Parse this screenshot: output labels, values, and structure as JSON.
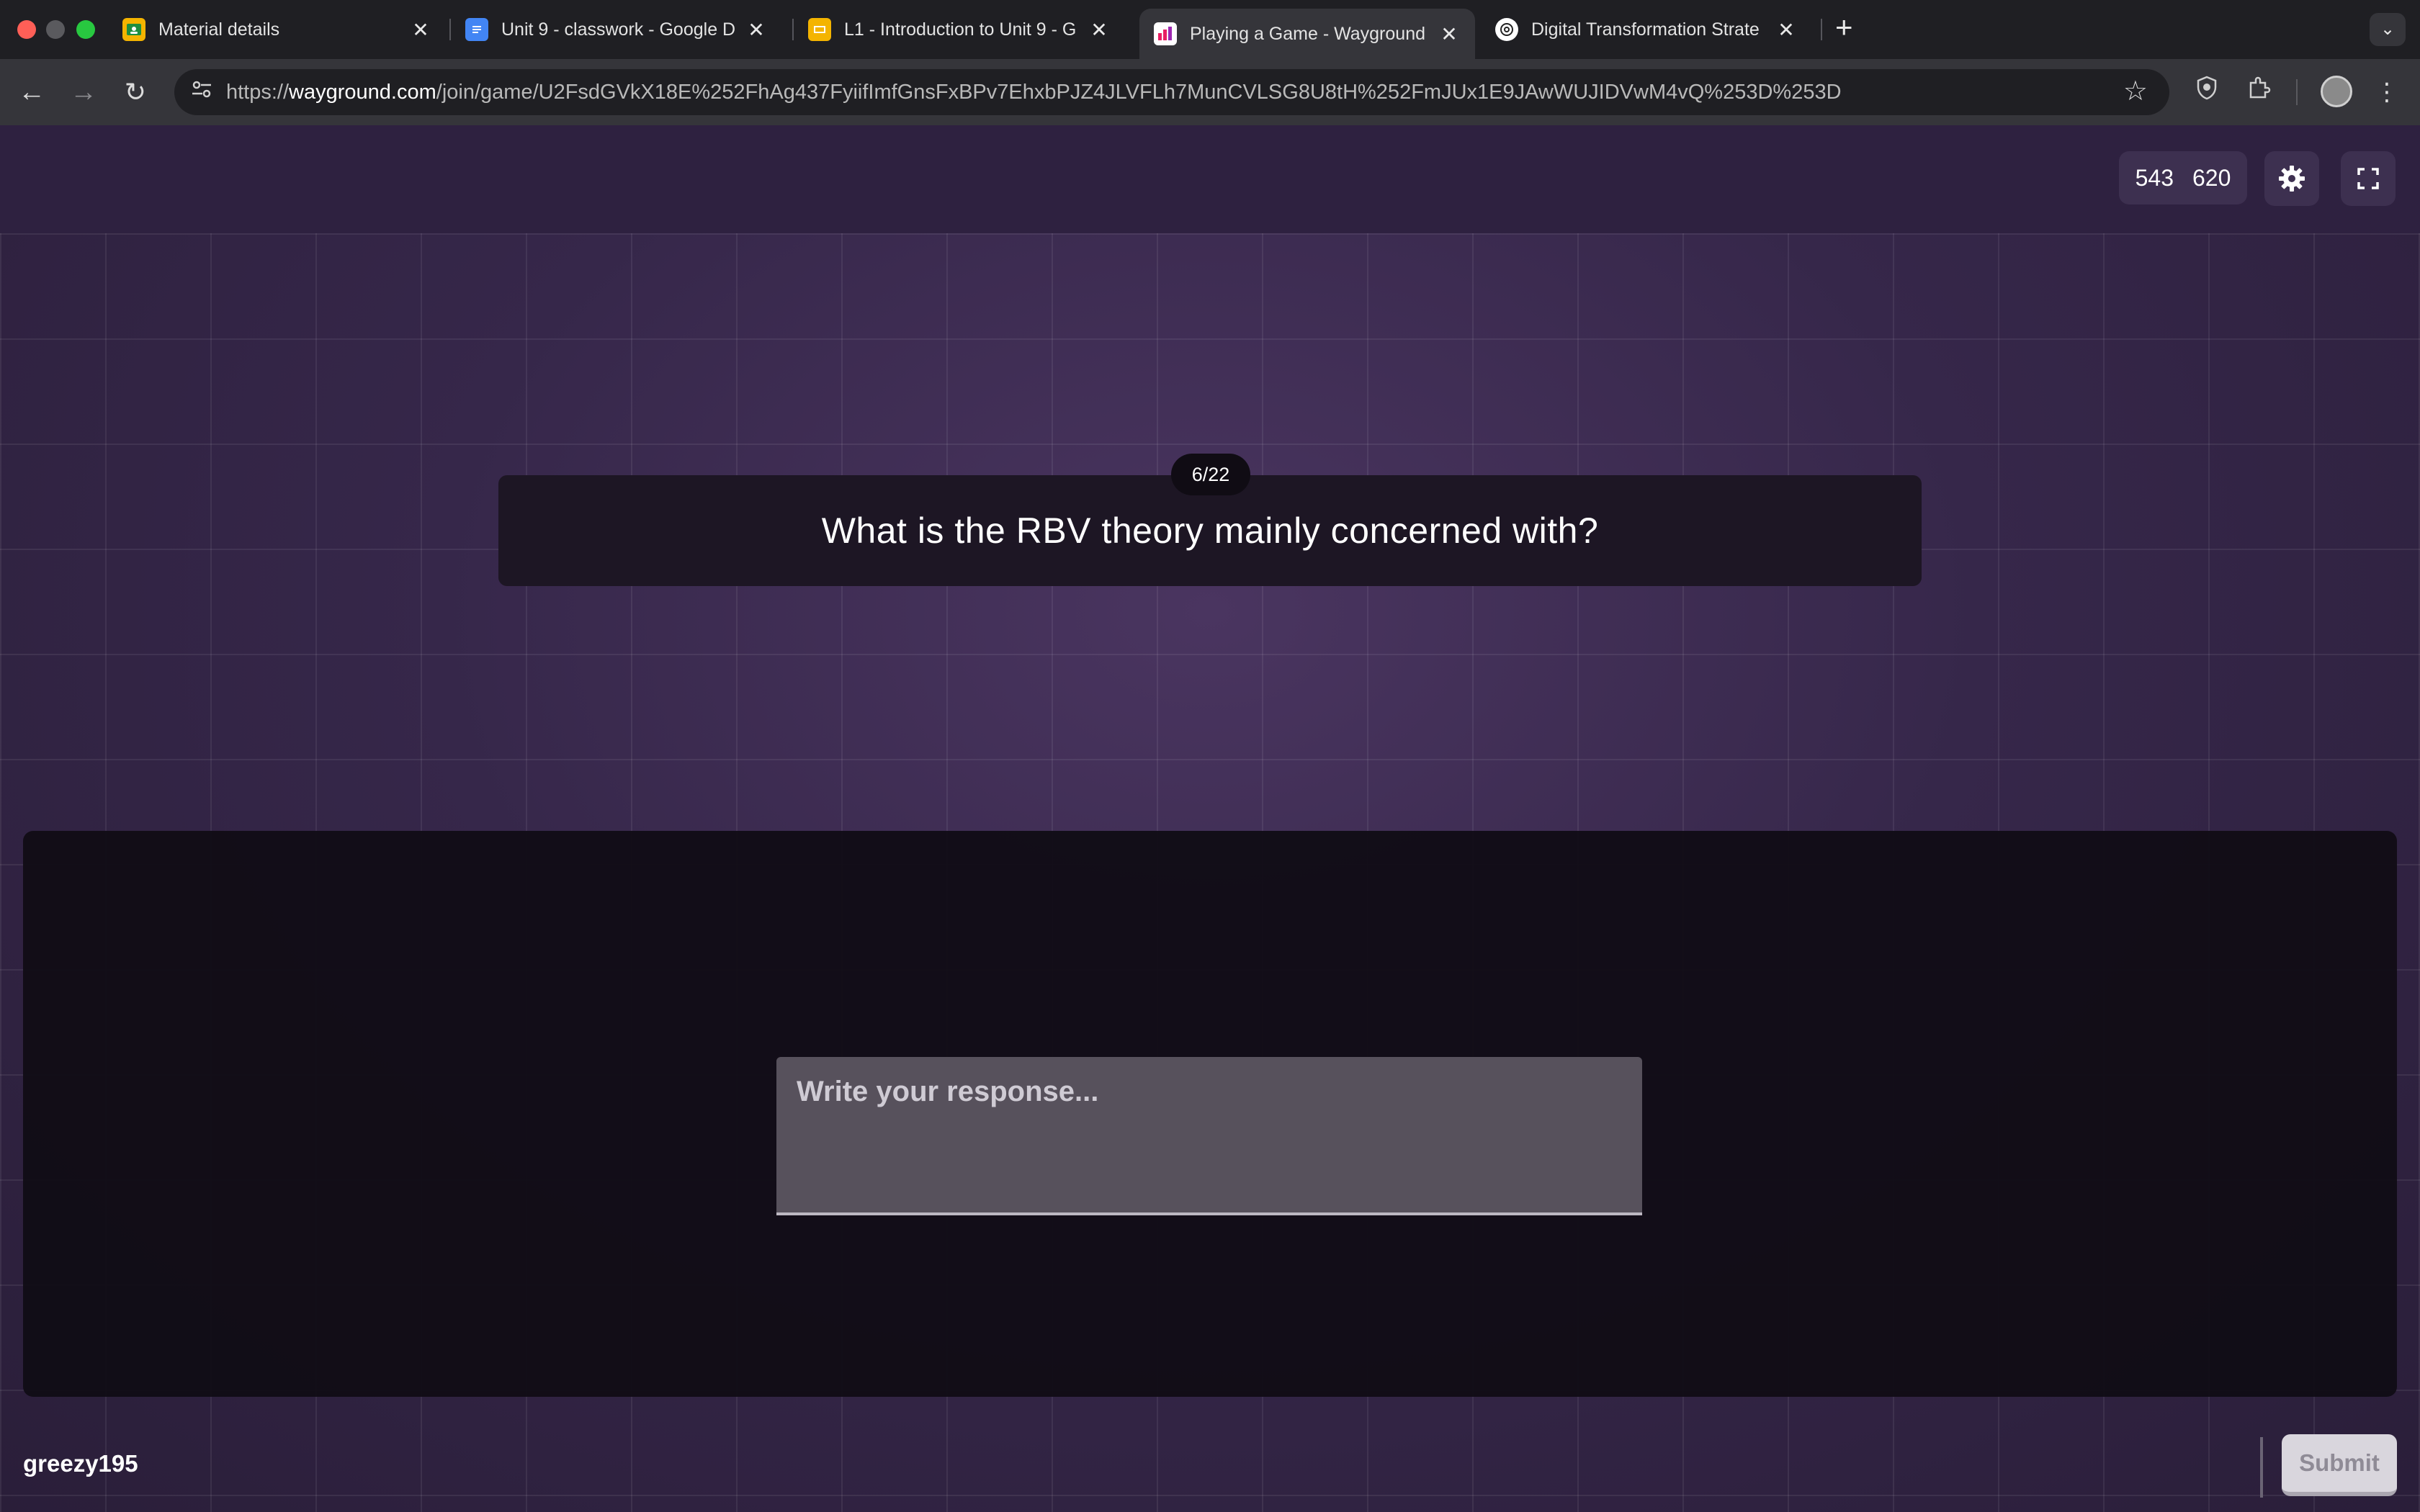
{
  "browser": {
    "tabs": [
      {
        "title": "Material details",
        "favicon": "classroom-icon",
        "active": false
      },
      {
        "title": "Unit 9 - classwork - Google D",
        "favicon": "docs-icon",
        "active": false
      },
      {
        "title": "L1 - Introduction to Unit 9 - G",
        "favicon": "slides-icon",
        "active": false
      },
      {
        "title": "Playing a Game - Wayground",
        "favicon": "wayground-icon",
        "active": true
      },
      {
        "title": "Digital Transformation Strate",
        "favicon": "chatgpt-icon",
        "active": false
      }
    ],
    "url_prefix": "https://",
    "url_host": "wayground.com",
    "url_path": "/join/game/U2FsdGVkX18E%252FhAg437FyiifImfGnsFxBPv7EhxbPJZ4JLVFLh7MunCVLSG8U8tH%252FmJUx1E9JAwWUJIDVwM4vQ%253D%253D"
  },
  "game": {
    "score_a": "543",
    "score_b": "620",
    "question_counter": "6/22",
    "question": "What is the RBV theory mainly concerned with?",
    "response_placeholder": "Write your response...",
    "username": "greezy195",
    "submit_label": "Submit"
  },
  "colors": {
    "page_bg": "#36274a",
    "card_bg": "#1d1624",
    "input_bg": "#57515c",
    "submit_bg": "#d9d6dd"
  }
}
